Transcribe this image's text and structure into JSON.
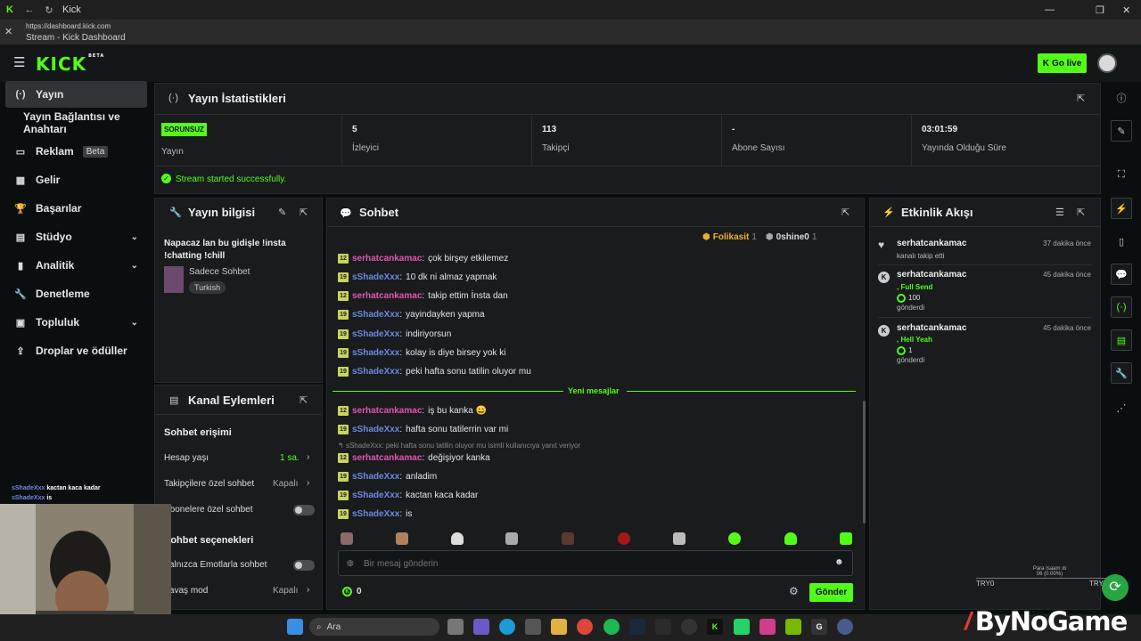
{
  "window": {
    "title": "Kick"
  },
  "url": {
    "address": "https://dashboard.kick.com",
    "page_title": "Stream - Kick Dashboard"
  },
  "topbar": {
    "logo": "KICK",
    "logo_badge": "BETA",
    "go_live": "Go live"
  },
  "sidebar": {
    "items": [
      {
        "label": "Yayın",
        "icon": "broadcast-icon"
      },
      {
        "label": "Yayın Bağlantısı ve Anahtarı"
      },
      {
        "label": "Reklam",
        "badge": "Beta",
        "icon": "ad-icon"
      },
      {
        "label": "Gelir",
        "icon": "revenue-icon"
      },
      {
        "label": "Başarılar",
        "icon": "trophy-icon"
      },
      {
        "label": "Stüdyo",
        "icon": "studio-icon"
      },
      {
        "label": "Analitik",
        "icon": "analytics-icon"
      },
      {
        "label": "Denetleme",
        "icon": "wrench-icon"
      },
      {
        "label": "Topluluk",
        "icon": "community-icon"
      },
      {
        "label": "Droplar ve ödüller",
        "icon": "drops-icon"
      }
    ]
  },
  "stats": {
    "title": "Yayın İstatistikleri",
    "status_badge": "SORUNSUZ",
    "cells": [
      {
        "value": "",
        "label": "Yayın"
      },
      {
        "value": "5",
        "label": "İzleyici"
      },
      {
        "value": "113",
        "label": "Takipçi"
      },
      {
        "value": "-",
        "label": "Abone Sayısı"
      },
      {
        "value": "03:01:59",
        "label": "Yayında Olduğu Süre"
      }
    ],
    "notice": "Stream started successfully."
  },
  "stream_info": {
    "title": "Yayın bilgisi",
    "stream_title": "Napacaz lan bu gidişle !insta !chatting !chill",
    "category": "Sadece Sohbet",
    "tag": "Turkish"
  },
  "channel_actions": {
    "title": "Kanal Eylemleri",
    "chat_access": "Sohbet erişimi",
    "account_age_label": "Hesap yaşı",
    "account_age_value": "1 sa.",
    "followers_only_label": "Takipçilere özel sohbet",
    "followers_only_value": "Kapalı",
    "subs_only_label": "Abonelere özel sohbet",
    "chat_options": "Sohbet seçenekleri",
    "emote_only_label": "Yalnızca Emotlarla sohbet",
    "slow_mode_label": "Yavaş mod",
    "slow_mode_value": "Kapalı"
  },
  "chat": {
    "title": "Sohbet",
    "pinned_users": [
      {
        "name": "Folikasit",
        "count": "1"
      },
      {
        "name": "0shine0",
        "count": "1"
      }
    ],
    "messages_before": [
      {
        "lvl": "12",
        "user": "serhatcankamac",
        "color": "pink",
        "text": "çok birşey etkilemez"
      },
      {
        "lvl": "19",
        "user": "sShadeXxx",
        "color": "blue",
        "text": "10 dk ni almaz yapmak"
      },
      {
        "lvl": "12",
        "user": "serhatcankamac",
        "color": "pink",
        "text": "takip ettim İnsta dan"
      },
      {
        "lvl": "19",
        "user": "sShadeXxx",
        "color": "blue",
        "text": "yayindayken yapma"
      },
      {
        "lvl": "19",
        "user": "sShadeXxx",
        "color": "blue",
        "text": "indiriyorsun"
      },
      {
        "lvl": "19",
        "user": "sShadeXxx",
        "color": "blue",
        "text": "kolay is diye birsey yok ki"
      },
      {
        "lvl": "19",
        "user": "sShadeXxx",
        "color": "blue",
        "text": "peki hafta sonu tatilin oluyor mu"
      }
    ],
    "new_messages_divider": "Yeni mesajlar",
    "messages_after_1": [
      {
        "lvl": "12",
        "user": "serhatcankamac",
        "color": "pink",
        "text": "iş bu kanka 😄"
      },
      {
        "lvl": "19",
        "user": "sShadeXxx",
        "color": "blue",
        "text": "hafta sonu tatilerrin var mi"
      }
    ],
    "reply_hint": "sShadeXxx: peki hafta sonu tatilin oluyor mu isimli kullanıcıya yanıt veriyor",
    "messages_after_2": [
      {
        "lvl": "12",
        "user": "serhatcankamac",
        "color": "pink",
        "text": "değişiyor kanka"
      },
      {
        "lvl": "19",
        "user": "sShadeXxx",
        "color": "blue",
        "text": "anladim"
      },
      {
        "lvl": "19",
        "user": "sShadeXxx",
        "color": "blue",
        "text": "kactan kaca kadar"
      },
      {
        "lvl": "19",
        "user": "sShadeXxx",
        "color": "blue",
        "text": "is"
      }
    ],
    "input_placeholder": "Bir mesaj gönderin",
    "points": "0",
    "send": "Gönder"
  },
  "activity": {
    "title": "Etkinlik Akışı",
    "events": [
      {
        "user": "serhatcankamac",
        "time": "37 dakika önce",
        "line1": "kanalı takip etti",
        "green": "",
        "amount": "",
        "line2": ""
      },
      {
        "user": "serhatcankamac",
        "time": "45 dakika önce",
        "line1": "",
        "green": ", Full Send",
        "amount": "100",
        "line2": "gönderdi"
      },
      {
        "user": "serhatcankamac",
        "time": "45 dakika önce",
        "line1": "",
        "green": ", Hell Yeah",
        "amount": "1",
        "line2": "gönderdi"
      }
    ]
  },
  "overlay": {
    "chat_lines": [
      {
        "user": "sShadeXxx",
        "text": "kactan kaca kadar"
      },
      {
        "user": "sShadeXxx",
        "text": "is"
      }
    ],
    "brand": "ByNoGame",
    "try_left": "TRY0",
    "try_right": "TRY",
    "mini_line1": "Para Isaam ıb",
    "mini_line2": "06 (0.00%)"
  },
  "taskbar": {
    "search": "Ara"
  },
  "colors": {
    "accent": "#53fc18",
    "background": "#0b0e0f",
    "panel": "#191b1d"
  }
}
